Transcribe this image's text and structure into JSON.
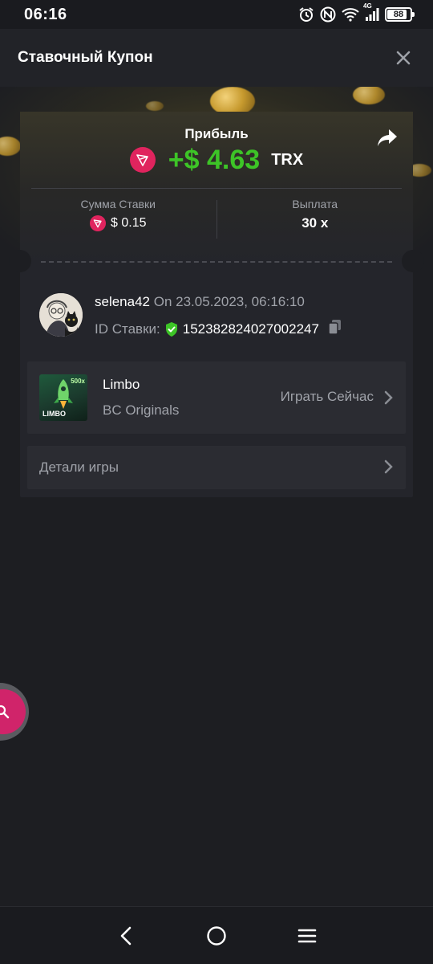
{
  "status_bar": {
    "time": "06:16",
    "network_label": "4G",
    "battery_level": "88",
    "battery_percent": 88,
    "icons": [
      "alarm-icon",
      "nfc-icon",
      "wifi-icon",
      "signal-icon",
      "battery-icon"
    ]
  },
  "header": {
    "title": "Ставочный Купон",
    "close_icon": "close-icon"
  },
  "coupon": {
    "profit_label": "Прибыль",
    "profit_value": "+$ 4.63",
    "profit_currency": "TRX",
    "share_icon": "share-icon",
    "bet_amount_label": "Сумма Ставки",
    "bet_amount_value": "$ 0.15",
    "payout_label": "Выплата",
    "payout_value": "30 x",
    "coin_icon": "trx-coin-icon"
  },
  "user": {
    "name": "selena42",
    "date": "On 23.05.2023, 06:16:10",
    "bet_id_label": "ID Ставки:",
    "bet_id_value": "152382824027002247"
  },
  "game": {
    "name": "Limbo",
    "provider": "BC Originals",
    "play_label": "Играть Сейчас",
    "thumb_label": "LIMBO",
    "thumb_badge": "500x"
  },
  "details": {
    "label": "Детали игры"
  },
  "colors": {
    "profit_green": "#3dc427",
    "trx_red": "#e0245e",
    "fab_pink": "#d0246a",
    "verified_green": "#3dc427"
  }
}
